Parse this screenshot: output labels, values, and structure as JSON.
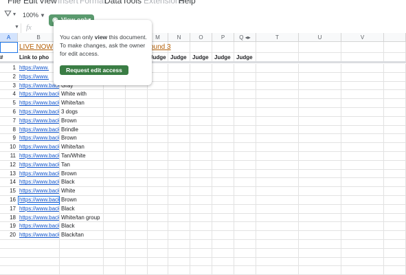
{
  "menubar": {
    "items": [
      {
        "label": "File",
        "enabled": true
      },
      {
        "label": "Edit",
        "enabled": true
      },
      {
        "label": "View",
        "enabled": true
      },
      {
        "label": "Insert",
        "enabled": false
      },
      {
        "label": "Format",
        "enabled": false
      },
      {
        "label": "Data",
        "enabled": true
      },
      {
        "label": "Tools",
        "enabled": true
      },
      {
        "label": "Extensions",
        "enabled": false
      },
      {
        "label": "Help",
        "enabled": true
      }
    ]
  },
  "toolbar": {
    "zoom": "100%",
    "view_only_label": "View only"
  },
  "formula_bar": {
    "fx": "fx"
  },
  "columns": [
    "A",
    "B",
    "",
    "",
    "",
    "",
    "",
    "M",
    "N",
    "O",
    "P",
    "Q",
    "",
    "T",
    "U",
    "V",
    ""
  ],
  "selected_column": "A",
  "sheet": {
    "title_cell": "LIVE NOW",
    "round_text": "ound 3",
    "header_link": "Link to pho",
    "judge_label": "Judge",
    "row_numbers": [
      "1",
      "2",
      "3",
      "4",
      "5",
      "6",
      "7",
      "8",
      "9",
      "10",
      "11",
      "12",
      "13",
      "14",
      "15",
      "16",
      "17",
      "18",
      "19",
      "20"
    ],
    "link_text": "https://www.back",
    "link_text_short": "https://www.",
    "colors": [
      "",
      "",
      "Gray",
      "White with",
      "White/tan",
      "3 dogs",
      "Brown",
      "Brindle",
      "Brown",
      "White/tan",
      "Tan/White",
      "Tan",
      "Brown",
      "Black",
      "White",
      "Brown",
      "Black",
      "White/tan group",
      "Black",
      "Black/tan"
    ]
  },
  "popup": {
    "message_before": "You can only ",
    "message_bold": "view",
    "message_after": " this document. To make changes, ask the owner for edit access.",
    "button_label": "Request edit access"
  },
  "accent_colors": {
    "view_only_bg": "#5a9a6e",
    "request_button_bg": "#3a7d44",
    "link": "#1155cc",
    "title": "#b45f06",
    "selection": "#1a73e8"
  }
}
